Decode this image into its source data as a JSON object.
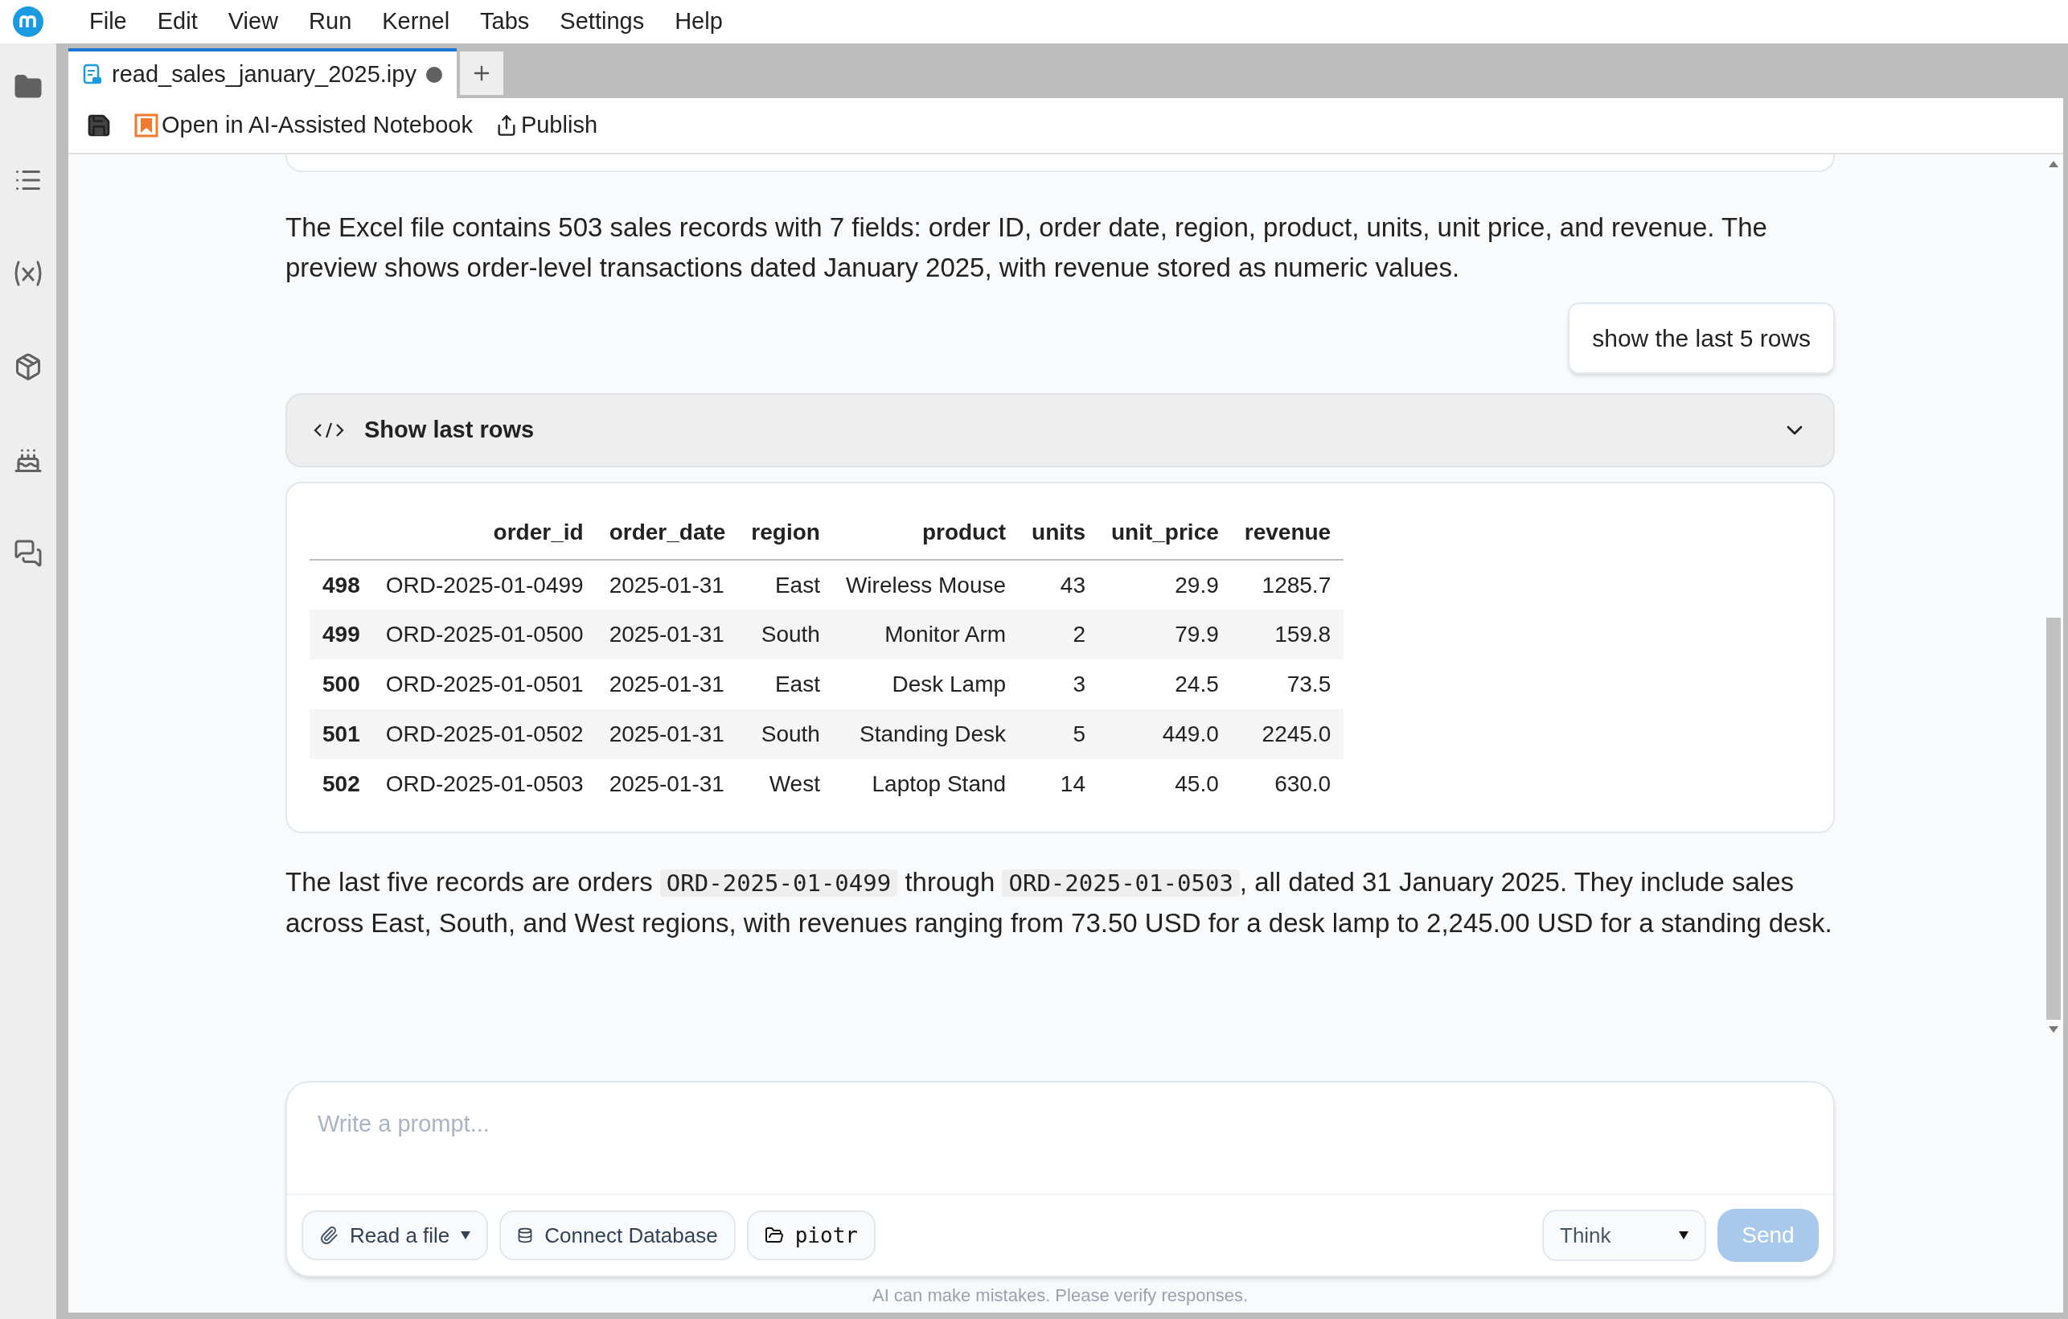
{
  "menu": [
    "File",
    "Edit",
    "View",
    "Run",
    "Kernel",
    "Tabs",
    "Settings",
    "Help"
  ],
  "sidebar": [
    {
      "kind": "folder",
      "selected": false
    },
    {
      "kind": "list",
      "selected": false
    },
    {
      "kind": "variable",
      "selected": false
    },
    {
      "kind": "package",
      "selected": false
    },
    {
      "kind": "cake",
      "selected": false
    },
    {
      "kind": "chat",
      "selected": false
    }
  ],
  "tabs": [
    {
      "label": "read_sales_january_2025.ipy",
      "selected": true,
      "unsaved": true
    }
  ],
  "toolbar": [
    {
      "kind": "save"
    },
    {
      "kind": "ai",
      "label": "Open in AI-Assisted Notebook"
    },
    {
      "kind": "publish",
      "label": "Publish"
    }
  ],
  "messages": [
    {
      "kind": "text",
      "text": "The Excel file contains 503 sales records with 7 fields: order ID, order date, region, product, units, unit price, and revenue. The preview shows order-level transactions dated January 2025, with revenue stored as numeric values."
    },
    {
      "kind": "user",
      "text": "show the last 5 rows"
    },
    {
      "kind": "code",
      "title": "Show last rows",
      "expanded": false
    },
    {
      "kind": "table",
      "columns": [
        "",
        "order_id",
        "order_date",
        "region",
        "product",
        "units",
        "unit_price",
        "revenue"
      ],
      "rows": [
        [
          "498",
          "ORD-2025-01-0499",
          "2025-01-31",
          "East",
          "Wireless Mouse",
          "43",
          "29.9",
          "1285.7"
        ],
        [
          "499",
          "ORD-2025-01-0500",
          "2025-01-31",
          "South",
          "Monitor Arm",
          "2",
          "79.9",
          "159.8"
        ],
        [
          "500",
          "ORD-2025-01-0501",
          "2025-01-31",
          "East",
          "Desk Lamp",
          "3",
          "24.5",
          "73.5"
        ],
        [
          "501",
          "ORD-2025-01-0502",
          "2025-01-31",
          "South",
          "Standing Desk",
          "5",
          "449.0",
          "2245.0"
        ],
        [
          "502",
          "ORD-2025-01-0503",
          "2025-01-31",
          "West",
          "Laptop Stand",
          "14",
          "45.0",
          "630.0"
        ]
      ]
    },
    {
      "kind": "rich",
      "parts": [
        {
          "kind": "text",
          "text": "The last five records are orders "
        },
        {
          "kind": "code",
          "text": "ORD-2025-01-0499"
        },
        {
          "kind": "text",
          "text": " through "
        },
        {
          "kind": "code",
          "text": "ORD-2025-01-0503"
        },
        {
          "kind": "text",
          "text": ", all dated 31 January 2025. They include sales across East, South, and West regions, with revenues ranging from 73.50 USD for a desk lamp to 2,245.00 USD for a standing desk."
        }
      ]
    }
  ],
  "prompt": {
    "placeholder": "Write a prompt...",
    "tools": [
      {
        "kind": "file",
        "label": "Read a file",
        "dropdown": true
      },
      {
        "kind": "database",
        "label": "Connect Database",
        "dropdown": false
      },
      {
        "kind": "folder",
        "label": "piotr",
        "dropdown": false
      }
    ],
    "mode": "Think",
    "send": {
      "label": "Send",
      "disabled": true
    }
  },
  "footer": "AI can make mistakes. Please verify responses."
}
